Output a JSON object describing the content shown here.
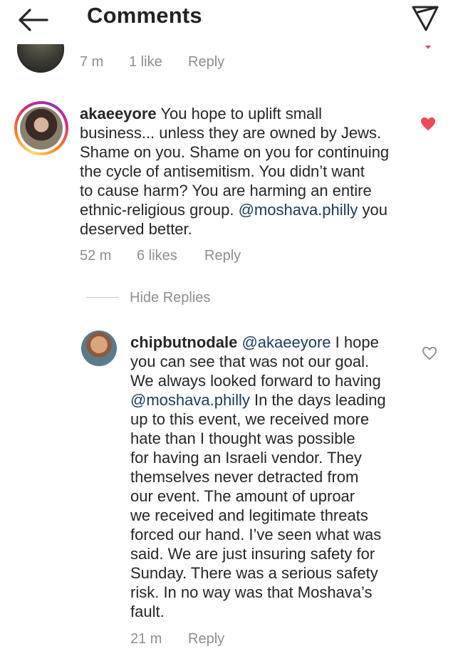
{
  "header": {
    "title": "Comments"
  },
  "prev_comment": {
    "time": "7 m",
    "likes": "1 like",
    "reply_label": "Reply"
  },
  "comment": {
    "username": "akaeeyore",
    "text_before_mention": " You hope to uplift small\nbusiness... unless they are owned by Jews.\nShame on you. Shame on you for continuing\nthe cycle of antisemitism. You didn’t want\nto cause harm? You are harming an entire\nethnic-religious group. ",
    "mention": "@moshava.philly",
    "text_after_mention": " you\ndeserved better.",
    "time": "52 m",
    "likes": "6 likes",
    "reply_label": "Reply",
    "liked": true,
    "hide_replies_label": "Hide Replies"
  },
  "reply": {
    "username": "chipbutnodale",
    "mention_1": "@akaeeyore",
    "text_1": " I hope\nyou can see that was not our goal.\nWe always looked forward to having\n",
    "mention_2": "@moshava.philly",
    "text_2": " In the days leading\nup to this event, we received more\nhate than I thought was possible\nfor having an Israeli vendor. They\nthemselves never detracted from\nour event. The amount of uproar\nwe received and legitimate threats\nforced our hand. I’ve seen what was\nsaid. We are just insuring safety for\nSunday. There was a serious safety\nrisk. In no way was that Moshava’s\nfault.",
    "time": "21 m",
    "reply_label": "Reply",
    "liked": false
  },
  "colors": {
    "like_red": "#ed4956",
    "meta_gray": "#8e8e8e",
    "mention_blue": "#1a3b5d"
  }
}
